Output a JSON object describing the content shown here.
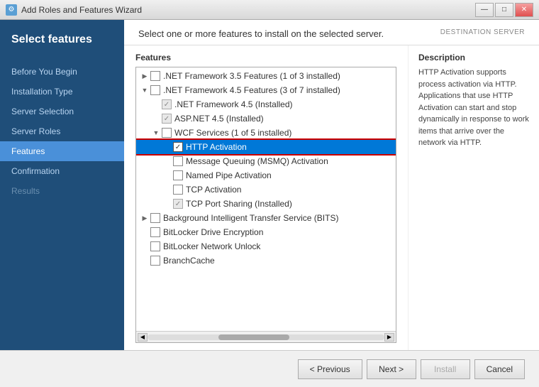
{
  "titlebar": {
    "title": "Add Roles and Features Wizard",
    "icon": "W",
    "min_btn": "—",
    "max_btn": "□",
    "close_btn": "✕"
  },
  "sidebar": {
    "header_title": "Select features",
    "items": [
      {
        "id": "before-you-begin",
        "label": "Before You Begin",
        "state": "normal"
      },
      {
        "id": "installation-type",
        "label": "Installation Type",
        "state": "normal"
      },
      {
        "id": "server-selection",
        "label": "Server Selection",
        "state": "normal"
      },
      {
        "id": "server-roles",
        "label": "Server Roles",
        "state": "normal"
      },
      {
        "id": "features",
        "label": "Features",
        "state": "active"
      },
      {
        "id": "confirmation",
        "label": "Confirmation",
        "state": "normal"
      },
      {
        "id": "results",
        "label": "Results",
        "state": "disabled"
      }
    ]
  },
  "header": {
    "instruction": "Select one or more features to install on the selected server.",
    "destination_label": "DESTINATION SERVER"
  },
  "features": {
    "label": "Features",
    "items": [
      {
        "id": "net35",
        "level": 0,
        "expandable": true,
        "expanded": false,
        "checkbox": "none",
        "label": ".NET Framework 3.5 Features (1 of 3 installed)"
      },
      {
        "id": "net45",
        "level": 0,
        "expandable": true,
        "expanded": true,
        "checkbox": "none",
        "label": ".NET Framework 4.5 Features (3 of 7 installed)"
      },
      {
        "id": "net45-core",
        "level": 1,
        "expandable": false,
        "expanded": false,
        "checkbox": "grayed",
        "label": ".NET Framework 4.5 (Installed)"
      },
      {
        "id": "asp45",
        "level": 1,
        "expandable": false,
        "expanded": false,
        "checkbox": "grayed",
        "label": "ASP.NET 4.5 (Installed)"
      },
      {
        "id": "wcf",
        "level": 1,
        "expandable": true,
        "expanded": true,
        "checkbox": "none",
        "label": "WCF Services (1 of 5 installed)"
      },
      {
        "id": "http-activation",
        "level": 2,
        "expandable": false,
        "expanded": false,
        "checkbox": "checked-highlight",
        "label": "HTTP Activation"
      },
      {
        "id": "msmq",
        "level": 2,
        "expandable": false,
        "expanded": false,
        "checkbox": "unchecked",
        "label": "Message Queuing (MSMQ) Activation"
      },
      {
        "id": "named-pipe",
        "level": 2,
        "expandable": false,
        "expanded": false,
        "checkbox": "unchecked",
        "label": "Named Pipe Activation"
      },
      {
        "id": "tcp-activation",
        "level": 2,
        "expandable": false,
        "expanded": false,
        "checkbox": "unchecked",
        "label": "TCP Activation"
      },
      {
        "id": "tcp-port",
        "level": 2,
        "expandable": false,
        "expanded": false,
        "checkbox": "grayed",
        "label": "TCP Port Sharing (Installed)"
      },
      {
        "id": "bits",
        "level": 0,
        "expandable": true,
        "expanded": false,
        "checkbox": "none",
        "label": "Background Intelligent Transfer Service (BITS)"
      },
      {
        "id": "bitlocker",
        "level": 0,
        "expandable": false,
        "expanded": false,
        "checkbox": "unchecked",
        "label": "BitLocker Drive Encryption"
      },
      {
        "id": "bitlocker-network",
        "level": 0,
        "expandable": false,
        "expanded": false,
        "checkbox": "unchecked",
        "label": "BitLocker Network Unlock"
      },
      {
        "id": "branchcache",
        "level": 0,
        "expandable": false,
        "expanded": false,
        "checkbox": "unchecked",
        "label": "BranchCache"
      }
    ]
  },
  "description": {
    "title": "Description",
    "text": "HTTP Activation supports process activation via HTTP. Applications that use HTTP Activation can start and stop dynamically in response to work items that arrive over the network via HTTP."
  },
  "footer": {
    "previous_label": "< Previous",
    "next_label": "Next >",
    "install_label": "Install",
    "cancel_label": "Cancel"
  }
}
